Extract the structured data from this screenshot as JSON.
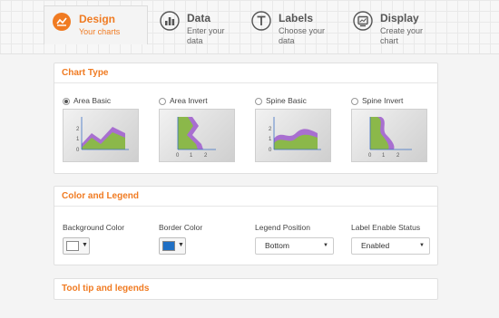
{
  "tabs": [
    {
      "title": "Design",
      "subtitle": "Your charts",
      "icon": "design-icon",
      "active": true
    },
    {
      "title": "Data",
      "subtitle": "Enter your data",
      "icon": "data-bars-icon"
    },
    {
      "title": "Labels",
      "subtitle": "Choose your data",
      "icon": "labels-text-icon"
    },
    {
      "title": "Display",
      "subtitle": "Create your chart",
      "icon": "display-icon"
    }
  ],
  "chart_type": {
    "heading": "Chart Type",
    "options": [
      {
        "label": "Area Basic",
        "selected": true,
        "y_ticks": [
          "0",
          "1",
          "2"
        ],
        "x_ticks": []
      },
      {
        "label": "Area Invert",
        "selected": false,
        "y_ticks": [],
        "x_ticks": [
          "0",
          "1",
          "2"
        ]
      },
      {
        "label": "Spine Basic",
        "selected": false,
        "y_ticks": [
          "0",
          "1",
          "2"
        ],
        "x_ticks": []
      },
      {
        "label": "Spine Invert",
        "selected": false,
        "y_ticks": [],
        "x_ticks": [
          "0",
          "1",
          "2"
        ]
      }
    ]
  },
  "color_legend": {
    "heading": "Color and Legend",
    "background_color": {
      "label": "Background Color",
      "value": "#ffffff"
    },
    "border_color": {
      "label": "Border Color",
      "value": "#1f6fc4"
    },
    "legend_position": {
      "label": "Legend Position",
      "value": "Bottom"
    },
    "label_enable": {
      "label": "Label Enable Status",
      "value": "Enabled"
    }
  },
  "tooltip": {
    "heading": "Tool tip and legends"
  },
  "colors": {
    "accent": "#f07b22",
    "area_purple": "#a86fd0",
    "area_green": "#8bb84a",
    "axis_blue": "#3a6fc4"
  }
}
